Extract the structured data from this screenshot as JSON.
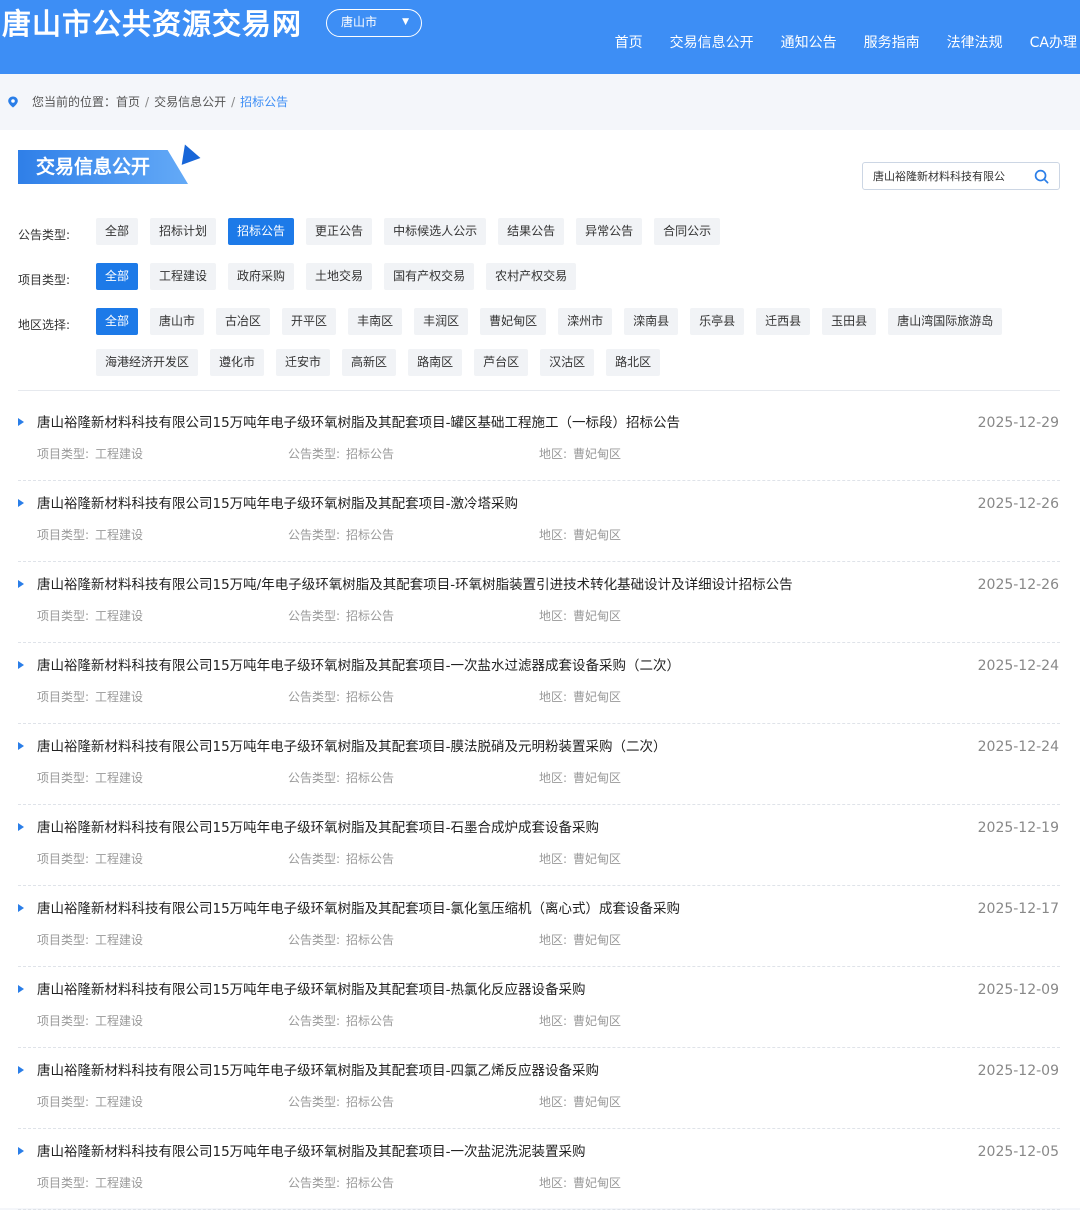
{
  "header": {
    "site_title": "唐山市公共资源交易网",
    "city_select": "唐山市",
    "nav": [
      "首页",
      "交易信息公开",
      "通知公告",
      "服务指南",
      "法律法规",
      "CA办理"
    ]
  },
  "breadcrumb": {
    "prefix": "您当前的位置：",
    "items": [
      "首页",
      "交易信息公开",
      "招标公告"
    ]
  },
  "section": {
    "title": "交易信息公开",
    "search_value": "唐山裕隆新材料科技有限公"
  },
  "filters": {
    "notice_type": {
      "label": "公告类型:",
      "options": [
        "全部",
        "招标计划",
        "招标公告",
        "更正公告",
        "中标候选人公示",
        "结果公告",
        "异常公告",
        "合同公示"
      ],
      "active": "招标公告"
    },
    "project_type": {
      "label": "项目类型:",
      "options": [
        "全部",
        "工程建设",
        "政府采购",
        "土地交易",
        "国有产权交易",
        "农村产权交易"
      ],
      "active": "全部"
    },
    "region": {
      "label": "地区选择:",
      "row1": [
        "全部",
        "唐山市",
        "古冶区",
        "开平区",
        "丰南区",
        "丰润区",
        "曹妃甸区",
        "滦州市",
        "滦南县",
        "乐亭县",
        "迁西县",
        "玉田县",
        "唐山湾国际旅游岛"
      ],
      "row2": [
        "海港经济开发区",
        "遵化市",
        "迁安市",
        "高新区",
        "路南区",
        "芦台区",
        "汉沽区",
        "路北区"
      ],
      "active": "全部"
    }
  },
  "meta_labels": {
    "project_type": "项目类型:",
    "notice_type": "公告类型:",
    "region": "地区:"
  },
  "items": [
    {
      "title": "唐山裕隆新材料科技有限公司15万吨年电子级环氧树脂及其配套项目-罐区基础工程施工（一标段）招标公告",
      "date": "2025-12-29",
      "project_type": "工程建设",
      "notice_type": "招标公告",
      "region": "曹妃甸区"
    },
    {
      "title": "唐山裕隆新材料科技有限公司15万吨年电子级环氧树脂及其配套项目-激冷塔采购",
      "date": "2025-12-26",
      "project_type": "工程建设",
      "notice_type": "招标公告",
      "region": "曹妃甸区"
    },
    {
      "title": "唐山裕隆新材料科技有限公司15万吨/年电子级环氧树脂及其配套项目-环氧树脂装置引进技术转化基础设计及详细设计招标公告",
      "date": "2025-12-26",
      "project_type": "工程建设",
      "notice_type": "招标公告",
      "region": "曹妃甸区"
    },
    {
      "title": "唐山裕隆新材料科技有限公司15万吨年电子级环氧树脂及其配套项目-一次盐水过滤器成套设备采购（二次）",
      "date": "2025-12-24",
      "project_type": "工程建设",
      "notice_type": "招标公告",
      "region": "曹妃甸区"
    },
    {
      "title": "唐山裕隆新材料科技有限公司15万吨年电子级环氧树脂及其配套项目-膜法脱硝及元明粉装置采购（二次）",
      "date": "2025-12-24",
      "project_type": "工程建设",
      "notice_type": "招标公告",
      "region": "曹妃甸区"
    },
    {
      "title": "唐山裕隆新材料科技有限公司15万吨年电子级环氧树脂及其配套项目-石墨合成炉成套设备采购",
      "date": "2025-12-19",
      "project_type": "工程建设",
      "notice_type": "招标公告",
      "region": "曹妃甸区"
    },
    {
      "title": "唐山裕隆新材料科技有限公司15万吨年电子级环氧树脂及其配套项目-氯化氢压缩机（离心式）成套设备采购",
      "date": "2025-12-17",
      "project_type": "工程建设",
      "notice_type": "招标公告",
      "region": "曹妃甸区"
    },
    {
      "title": "唐山裕隆新材料科技有限公司15万吨年电子级环氧树脂及其配套项目-热氯化反应器设备采购",
      "date": "2025-12-09",
      "project_type": "工程建设",
      "notice_type": "招标公告",
      "region": "曹妃甸区"
    },
    {
      "title": "唐山裕隆新材料科技有限公司15万吨年电子级环氧树脂及其配套项目-四氯乙烯反应器设备采购",
      "date": "2025-12-09",
      "project_type": "工程建设",
      "notice_type": "招标公告",
      "region": "曹妃甸区"
    },
    {
      "title": "唐山裕隆新材料科技有限公司15万吨年电子级环氧树脂及其配套项目-一次盐泥洗泥装置采购",
      "date": "2025-12-05",
      "project_type": "工程建设",
      "notice_type": "招标公告",
      "region": "曹妃甸区"
    }
  ],
  "colors": {
    "brand": "#3d8ef5",
    "active_chip": "#1d7ae8"
  }
}
